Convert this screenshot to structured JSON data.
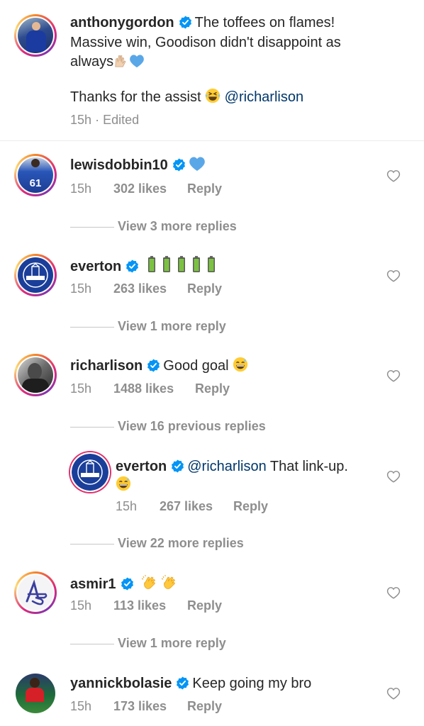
{
  "caption": {
    "username": "anthonygordon",
    "text_line1": "The toffees on flames!",
    "text_line2": "Massive win, Goodison didn't disappoint as",
    "text_line3": "always",
    "text_line5": "Thanks for the assist",
    "mention": "@richarlison",
    "time": "15h",
    "separator": "·",
    "edited": "Edited"
  },
  "comments": [
    {
      "username": "lewisdobbin10",
      "time": "15h",
      "likes": "302 likes",
      "reply": "Reply",
      "view_more": "View 3 more replies"
    },
    {
      "username": "everton",
      "time": "15h",
      "likes": "263 likes",
      "reply": "Reply",
      "view_more": "View 1 more reply"
    },
    {
      "username": "richarlison",
      "text": "Good goal",
      "time": "15h",
      "likes": "1488 likes",
      "reply": "Reply",
      "view_more": "View 16 previous replies"
    },
    {
      "username": "everton",
      "mention": "@richarlison",
      "text": "That link-up.",
      "time": "15h",
      "likes": "267 likes",
      "reply": "Reply",
      "view_more": "View 22 more replies"
    },
    {
      "username": "asmir1",
      "time": "15h",
      "likes": "113 likes",
      "reply": "Reply",
      "view_more": "View 1 more reply"
    },
    {
      "username": "yannickbolasie",
      "text": "Keep going my bro",
      "time": "15h",
      "likes": "173 likes",
      "reply": "Reply"
    }
  ],
  "colors": {
    "verified": "#0095f6",
    "mention": "#00376b",
    "secondary_text": "#8e8e8e",
    "everton_blue": "#1a3e9a"
  },
  "avatar_text": {
    "lewis_shirt_number": "61",
    "everton_badge": "Everton"
  },
  "icons": [
    "verified-icon",
    "heart-icon",
    "blue-heart-emoji",
    "raised-hands-emoji",
    "rofl-emoji",
    "battery-emoji",
    "grin-sweat-emoji",
    "clapping-hands-emoji"
  ]
}
